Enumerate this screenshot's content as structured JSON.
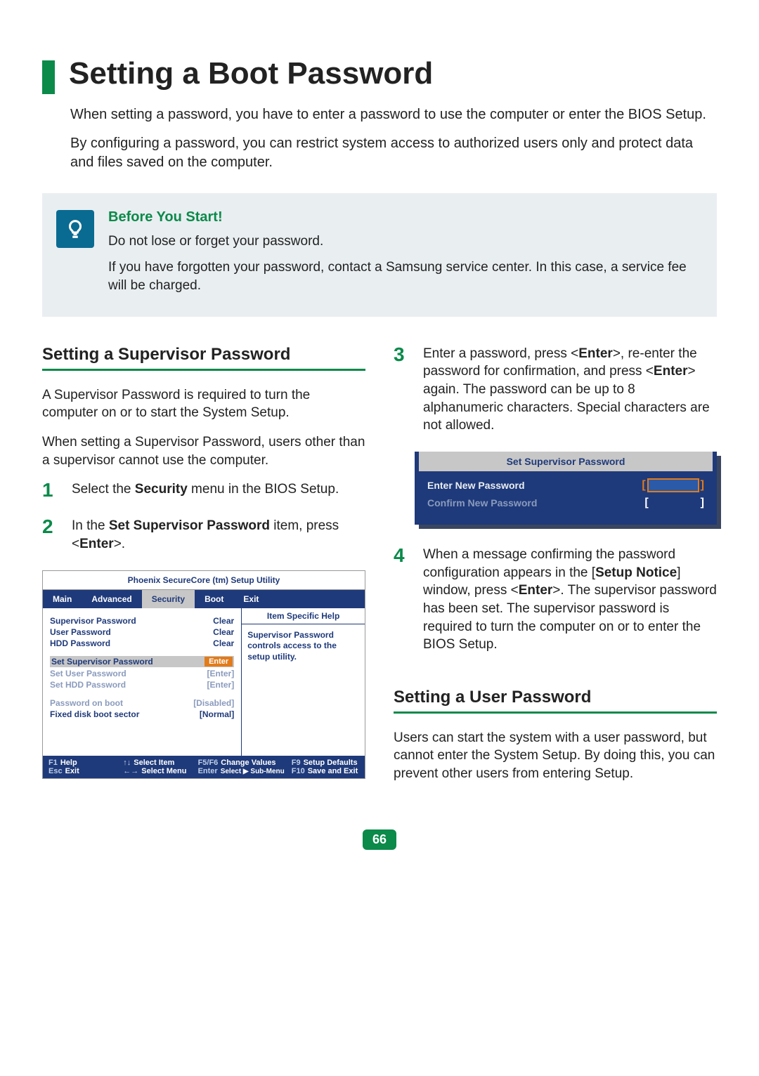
{
  "page": {
    "title": "Setting a Boot Password",
    "intro1": "When setting a password, you have to enter a password to use the computer or enter the BIOS Setup.",
    "intro2": "By configuring a password, you can restrict system access to authorized users only and protect data and files saved on the computer.",
    "number": "66"
  },
  "tip": {
    "heading": "Before You Start!",
    "line1": "Do not lose or forget your password.",
    "line2": "If you have forgotten your password, contact a Samsung service center. In this case, a service fee will be charged."
  },
  "supervisor": {
    "heading": "Setting a Supervisor Password",
    "para1": "A Supervisor Password is required to turn the computer on or to start the System Setup.",
    "para2": "When setting a Supervisor Password, users other than a supervisor cannot use the computer.",
    "step1_pre": "Select the ",
    "step1_bold": "Security",
    "step1_post": " menu in the BIOS Setup.",
    "step2_pre": "In the ",
    "step2_bold": "Set Supervisor Password",
    "step2_post": " item, press <",
    "step2_key": "Enter",
    "step2_end": ">."
  },
  "right": {
    "step3_a": "Enter a password, press <",
    "step3_b1": "Enter",
    "step3_c": ">, re-enter the password for confirmation, and press <",
    "step3_b2": "Enter",
    "step3_d": "> again. The password can be up to 8 alphanumeric characters. Special characters are not allowed.",
    "step4_a": "When a message confirming the password configuration appears in the [",
    "step4_bold": "Setup Notice",
    "step4_b": "] window, press <",
    "step4_key": "Enter",
    "step4_c": ">. The supervisor password has been set. The supervisor password is required to turn the computer on or to enter the BIOS Setup."
  },
  "user": {
    "heading": "Setting a User Password",
    "para": "Users can start the system with a user password, but cannot enter the System Setup. By doing this, you can prevent other users from entering Setup."
  },
  "bios": {
    "utility_title": "Phoenix SecureCore (tm) Setup Utility",
    "tabs": [
      "Main",
      "Advanced",
      "Security",
      "Boot",
      "Exit"
    ],
    "help_title": "Item Specific Help",
    "help_text": "Supervisor Password controls access to the setup utility.",
    "status": [
      {
        "label": "Supervisor Password",
        "value": "Clear"
      },
      {
        "label": "User Password",
        "value": "Clear"
      },
      {
        "label": "HDD Password",
        "value": "Clear"
      }
    ],
    "set_items": [
      {
        "label": "Set Supervisor Password",
        "value": "Enter",
        "highlight": true
      },
      {
        "label": "Set User Password",
        "value": "[Enter]"
      },
      {
        "label": "Set HDD Password",
        "value": "[Enter]"
      }
    ],
    "options": [
      {
        "label": "Password on boot",
        "value": "[Disabled]"
      },
      {
        "label": "Fixed disk boot sector",
        "value": "[Normal]"
      }
    ],
    "footer": {
      "r1": [
        {
          "k": "F1",
          "v": "Help"
        },
        {
          "k": "↑↓",
          "v": "Select Item"
        },
        {
          "k": "F5/F6",
          "v": "Change Values"
        },
        {
          "k": "F9",
          "v": "Setup Defaults"
        }
      ],
      "r2": [
        {
          "k": "Esc",
          "v": "Exit"
        },
        {
          "k": "←→",
          "v": "Select Menu"
        },
        {
          "k": "Enter",
          "v": "Select ▶ Sub-Menu"
        },
        {
          "k": "F10",
          "v": "Save and Exit"
        }
      ]
    }
  },
  "pwd_dialog": {
    "title": "Set Supervisor Password",
    "row1": "Enter New Password",
    "row2": "Confirm New Password"
  },
  "nums": {
    "1": "1",
    "2": "2",
    "3": "3",
    "4": "4"
  }
}
